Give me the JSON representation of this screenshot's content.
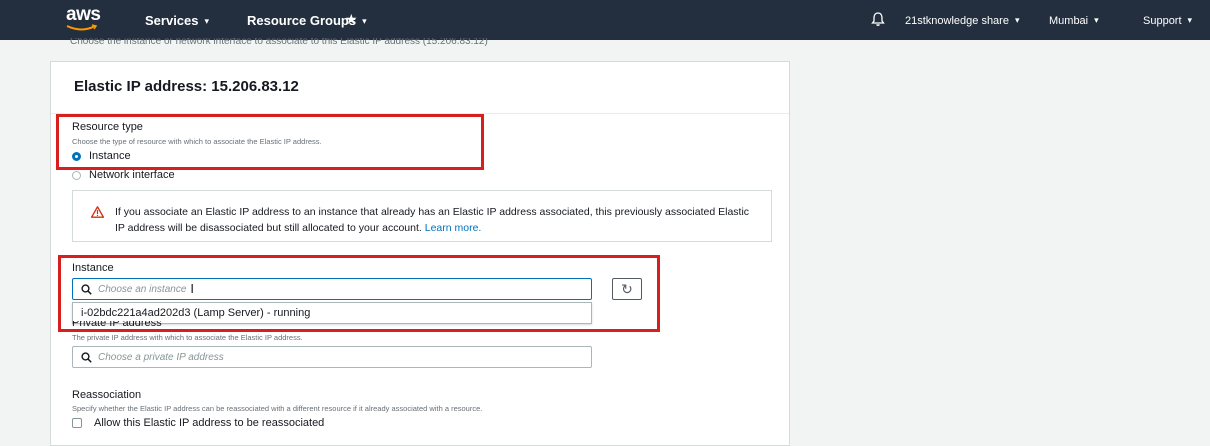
{
  "topbar": {
    "logo": "aws",
    "services": "Services",
    "resource_groups": "Resource Groups",
    "pin": "★",
    "account": "21stknowledge share",
    "region": "Mumbai",
    "support": "Support",
    "caret": "▾"
  },
  "cut_text": "Choose the instance or network interface to associate to this Elastic IP address (15.206.83.12)",
  "panel": {
    "title": "Elastic IP address: 15.206.83.12"
  },
  "resource_type": {
    "label": "Resource type",
    "description": "Choose the type of resource with which to associate the Elastic IP address.",
    "options": [
      {
        "label": "Instance",
        "checked": true
      },
      {
        "label": "Network interface",
        "checked": false
      }
    ]
  },
  "alert": {
    "text": "If you associate an Elastic IP address to an instance that already has an Elastic IP address associated, this previously associated Elastic IP address will be disassociated but still allocated to your account.",
    "link": "Learn more."
  },
  "instance": {
    "label": "Instance",
    "placeholder": "Choose an instance",
    "cursor": "I",
    "refresh": "↻",
    "option": "i-02bdc221a4ad202d3 (Lamp Server) - running"
  },
  "private_ip": {
    "label": "Private IP address",
    "description": "The private IP address with which to associate the Elastic IP address.",
    "placeholder": "Choose a private IP address"
  },
  "reassociation": {
    "label": "Reassociation",
    "description": "Specify whether the Elastic IP address can be reassociated with a different resource if it already associated with a resource.",
    "checkbox_label": "Allow this Elastic IP address to be reassociated"
  },
  "colors": {
    "topbar": "#232f3e",
    "accent": "#0073bb",
    "highlight": "#d7201e",
    "warning": "#d13212"
  }
}
